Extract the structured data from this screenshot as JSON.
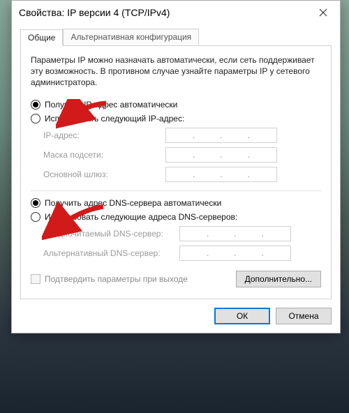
{
  "window": {
    "title": "Свойства: IP версии 4 (TCP/IPv4)"
  },
  "tabs": {
    "general": "Общие",
    "altconfig": "Альтернативная конфигурация"
  },
  "description": "Параметры IP можно назначать автоматически, если сеть поддерживает эту возможность. В противном случае узнайте параметры IP у сетевого администратора.",
  "ip_section": {
    "auto": "Получить IP-адрес автоматически",
    "manual": "Использовать следующий IP-адрес:",
    "fields": {
      "ip": "IP-адрес:",
      "mask": "Маска подсети:",
      "gateway": "Основной шлюз:"
    }
  },
  "dns_section": {
    "auto": "Получить адрес DNS-сервера автоматически",
    "manual": "Использовать следующие адреса DNS-серверов:",
    "fields": {
      "preferred": "Предпочитаемый DNS-сервер:",
      "alternate": "Альтернативный DNS-сервер:"
    }
  },
  "confirm_checkbox": "Подтвердить параметры при выходе",
  "buttons": {
    "advanced": "Дополнительно...",
    "ok": "ОК",
    "cancel": "Отмена"
  }
}
